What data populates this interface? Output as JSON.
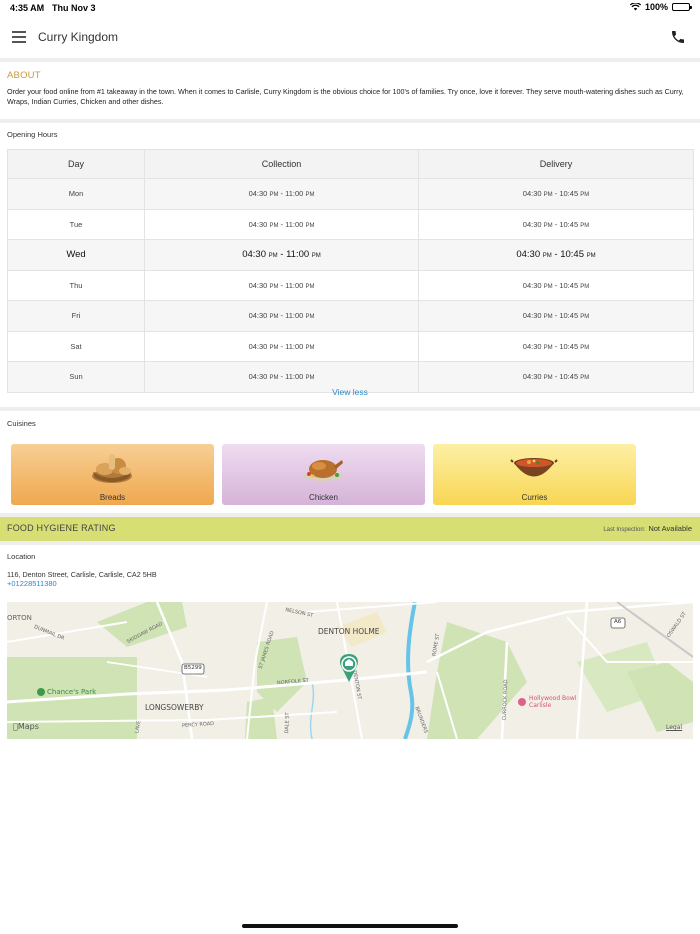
{
  "status_bar": {
    "time": "4:35 AM",
    "date": "Thu Nov 3",
    "battery": "100%"
  },
  "app_bar": {
    "title": "Curry Kingdom"
  },
  "about": {
    "title": "ABOUT",
    "text": "Order your food online from #1 takeaway in the town. When it comes to Carlisle, Curry Kingdom is the obvious choice for 100's of families. Try once, love it forever. They serve mouth-watering dishes such as Curry, Wraps, Indian Curries, Chicken and other dishes."
  },
  "opening_hours": {
    "label": "Opening Hours",
    "headers": [
      "Day",
      "Collection",
      "Delivery"
    ],
    "rows": [
      {
        "day": "Mon",
        "col_open": "04:30",
        "col_close": "11:00",
        "del_open": "04:30",
        "del_close": "10:45"
      },
      {
        "day": "Tue",
        "col_open": "04:30",
        "col_close": "11:00",
        "del_open": "04:30",
        "del_close": "10:45"
      },
      {
        "day": "Wed",
        "col_open": "04:30",
        "col_close": "11:00",
        "del_open": "04:30",
        "del_close": "10:45"
      },
      {
        "day": "Thu",
        "col_open": "04:30",
        "col_close": "11:00",
        "del_open": "04:30",
        "del_close": "10:45"
      },
      {
        "day": "Fri",
        "col_open": "04:30",
        "col_close": "11:00",
        "del_open": "04:30",
        "del_close": "10:45"
      },
      {
        "day": "Sat",
        "col_open": "04:30",
        "col_close": "11:00",
        "del_open": "04:30",
        "del_close": "10:45"
      },
      {
        "day": "Sun",
        "col_open": "04:30",
        "col_close": "11:00",
        "del_open": "04:30",
        "del_close": "10:45"
      }
    ],
    "pm": "PM",
    "dash": "-",
    "view_less": "View less"
  },
  "cuisines": {
    "label": "Cuisines",
    "items": [
      {
        "label": "Breads",
        "icon": "bread-basket-icon",
        "color_top": "#f7cf95",
        "color_bottom": "#efa84f"
      },
      {
        "label": "Chicken",
        "icon": "roast-chicken-icon",
        "color_top": "#eedcf0",
        "color_bottom": "#d6b3d9"
      },
      {
        "label": "Curries",
        "icon": "curry-bowl-icon",
        "color_top": "#fdf0a6",
        "color_bottom": "#f8d652"
      }
    ]
  },
  "hygiene": {
    "title": "FOOD HYGIENE RATING",
    "inspection_label": "Last Inspection:",
    "inspection_value": "Not Available"
  },
  "location": {
    "label": "Location",
    "address": "116, Denton Street, Carlisle, Carlisle, CA2 5HB",
    "phone": "+01228511380"
  },
  "map": {
    "labels": {
      "orton": "ORTON",
      "dunmail": "DUNMAIL DR",
      "skiddaw": "SKIDDAW ROAD",
      "nelson": "NELSON ST",
      "denton_holme": "DENTON HOLME",
      "st_james": "ST JAMES ROAD",
      "b5299": "B5299",
      "norfolk": "NORFOLK ST",
      "rome": "ROME ST",
      "a6": "A6",
      "oswald": "OSWALD ST",
      "chances_park": "Chance's Park",
      "longsowerby": "LONGSOWERBY",
      "percy": "PERCY ROAD",
      "currock": "CURROCK ROAD",
      "hollywood": "Hollywood Bowl Carlisle",
      "denton_st": "DENTON ST",
      "dunmail_dr": "DUNMAIL DR",
      "lave": "LAVE",
      "dale": "DALE ST",
      "brown": "BRUNDERS",
      "maps": "Maps",
      "legal": "Legal"
    }
  }
}
